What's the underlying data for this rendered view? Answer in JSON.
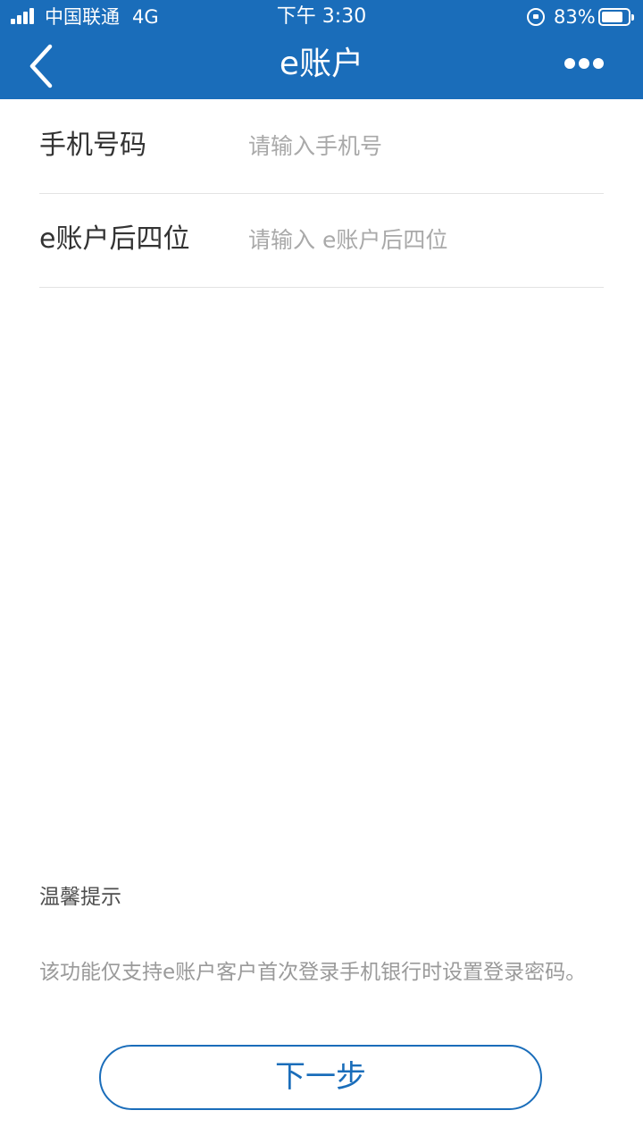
{
  "status_bar": {
    "carrier": "中国联通",
    "network": "4G",
    "time": "下午 3:30",
    "battery": "83%",
    "battery_level": 0.83,
    "signal_bars": 4
  },
  "nav": {
    "title": "e账户",
    "back_icon": "chevron-left-icon",
    "more_icon": "more-horizontal-icon"
  },
  "form": {
    "phone": {
      "label": "手机号码",
      "placeholder": "请输入手机号",
      "value": ""
    },
    "account_last4": {
      "label": "e账户后四位",
      "placeholder": "请输入 e账户后四位",
      "value": ""
    }
  },
  "tips": {
    "title": "温馨提示",
    "text": "该功能仅支持e账户客户首次登录手机银行时设置登录密码。"
  },
  "actions": {
    "next_label": "下一步"
  },
  "colors": {
    "brand": "#1a6dba",
    "label": "#333333",
    "placeholder": "#a9a9a9",
    "divider": "#e3e3e3"
  }
}
